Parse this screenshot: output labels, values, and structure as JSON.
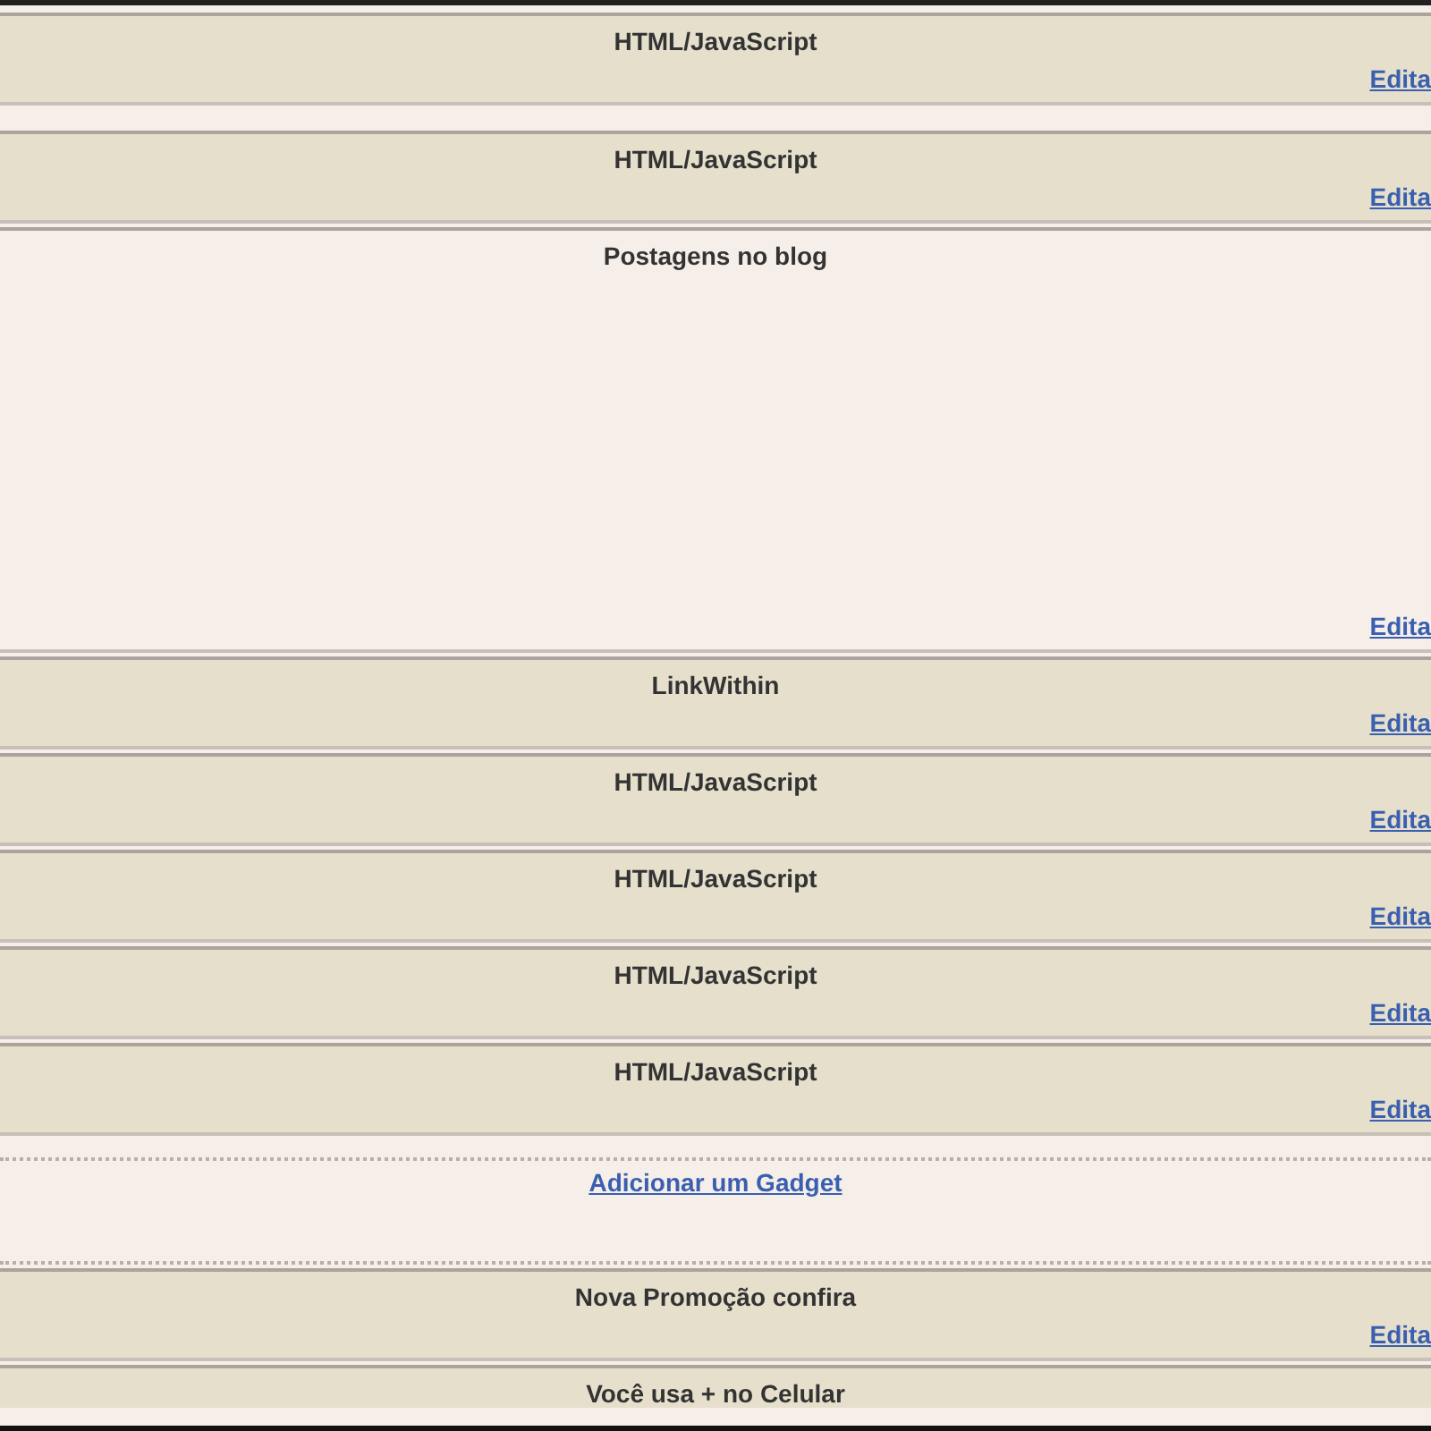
{
  "widgets": [
    {
      "kind": "gadget",
      "title": "HTML/JavaScript",
      "edit_link": "Edita"
    },
    {
      "kind": "spacer"
    },
    {
      "kind": "gadget",
      "title": "HTML/JavaScript",
      "edit_link": "Edita"
    },
    {
      "kind": "posts",
      "title": "Postagens no blog",
      "edit_link": "Edita"
    },
    {
      "kind": "gadget",
      "title": "LinkWithin",
      "edit_link": "Edita"
    },
    {
      "kind": "gadget",
      "title": "HTML/JavaScript",
      "edit_link": "Edita"
    },
    {
      "kind": "gadget",
      "title": "HTML/JavaScript",
      "edit_link": "Edita"
    },
    {
      "kind": "gadget",
      "title": "HTML/JavaScript",
      "edit_link": "Edita"
    },
    {
      "kind": "gadget",
      "title": "HTML/JavaScript",
      "edit_link": "Edita"
    },
    {
      "kind": "add",
      "link": "Adicionar um Gadget"
    },
    {
      "kind": "gadget",
      "title": "Nova Promoção confira",
      "edit_link": "Edita"
    },
    {
      "kind": "partial",
      "title": "Você usa + no Celular"
    }
  ]
}
